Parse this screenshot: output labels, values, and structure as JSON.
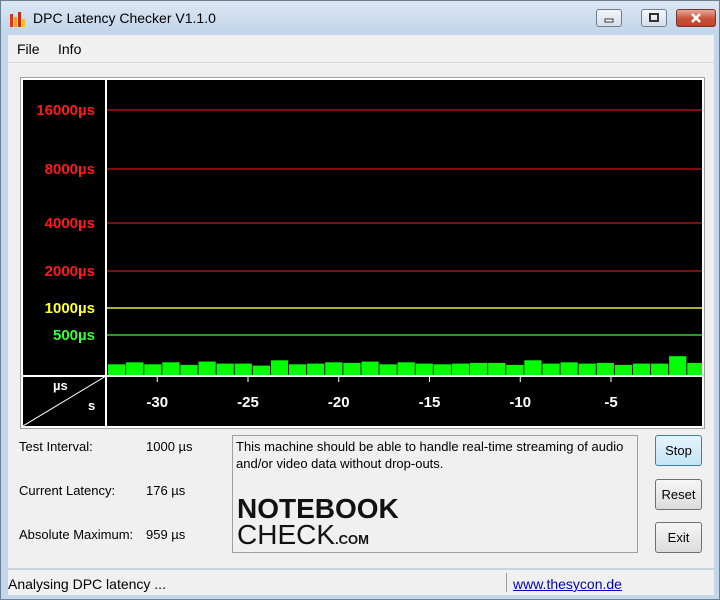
{
  "window": {
    "title": "DPC Latency Checker V1.1.0",
    "icon": "bar-chart-icon",
    "controls": [
      "minimize-icon",
      "maximize-icon",
      "close-icon"
    ]
  },
  "menu": {
    "items": [
      "File",
      "Info"
    ]
  },
  "graph": {
    "y_tick_labels": [
      {
        "label": "16000µs",
        "color": "#ff1a1a"
      },
      {
        "label": "8000µs",
        "color": "#ff1a1a"
      },
      {
        "label": "4000µs",
        "color": "#ff1a1a"
      },
      {
        "label": "2000µs",
        "color": "#ff1a1a"
      },
      {
        "label": "1000µs",
        "color": "#ffff33"
      },
      {
        "label": "500µs",
        "color": "#33ff33"
      }
    ],
    "x_tick_labels": [
      "-30",
      "-25",
      "-20",
      "-15",
      "-10",
      "-5"
    ],
    "corner_y_unit": "µs",
    "corner_x_unit": "s",
    "bar_color": "#00ff00",
    "background": "#000000",
    "bar_values_us": [
      160,
      190,
      160,
      190,
      150,
      200,
      170,
      170,
      140,
      220,
      160,
      170,
      190,
      180,
      200,
      160,
      190,
      170,
      160,
      170,
      180,
      180,
      150,
      220,
      170,
      190,
      170,
      180,
      150,
      170,
      170,
      280,
      180,
      170,
      150
    ]
  },
  "stats": {
    "test_interval_label": "Test Interval:",
    "test_interval_value": "1000 µs",
    "current_latency_label": "Current Latency:",
    "current_latency_value": "176 µs",
    "absolute_maximum_label": "Absolute Maximum:",
    "absolute_maximum_value": "959 µs"
  },
  "message": {
    "text": "This machine should be able to handle real-time streaming of audio and/or video data without drop-outs.",
    "logo_top": "NOTEBOOK",
    "logo_bottom": "CHECK",
    "logo_suffix": ".COM"
  },
  "buttons": {
    "stop": "Stop",
    "reset": "Reset",
    "exit": "Exit"
  },
  "status": {
    "text": "Analysing DPC latency ...",
    "link": "www.thesycon.de"
  }
}
